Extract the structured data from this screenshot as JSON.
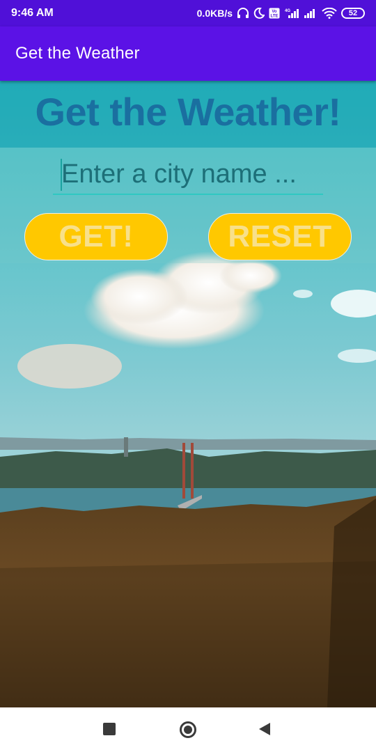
{
  "status_bar": {
    "time": "9:46 AM",
    "network_speed": "0.0KB/s",
    "network_type": "4G",
    "volte": "Vo LTE",
    "battery": "52",
    "icons": [
      "headset-icon",
      "moon-icon",
      "volte-icon",
      "signal-icon",
      "signal-icon",
      "wifi-icon",
      "battery-icon"
    ]
  },
  "app_bar": {
    "title": "Get the Weather"
  },
  "main": {
    "heading": "Get the Weather!",
    "city_input": {
      "placeholder": "Enter a city name ...",
      "value": ""
    },
    "get_button": "GET!",
    "reset_button": "RESET"
  },
  "nav_bar": {
    "buttons": [
      "recent-apps",
      "home",
      "back"
    ]
  },
  "colors": {
    "status_bar": "#5010d8",
    "app_bar": "#5b12e6",
    "button_fill": "#ffc800",
    "button_text": "#f8e08a",
    "heading": "#1a6fa0",
    "input_underline": "#2fc8c2"
  }
}
